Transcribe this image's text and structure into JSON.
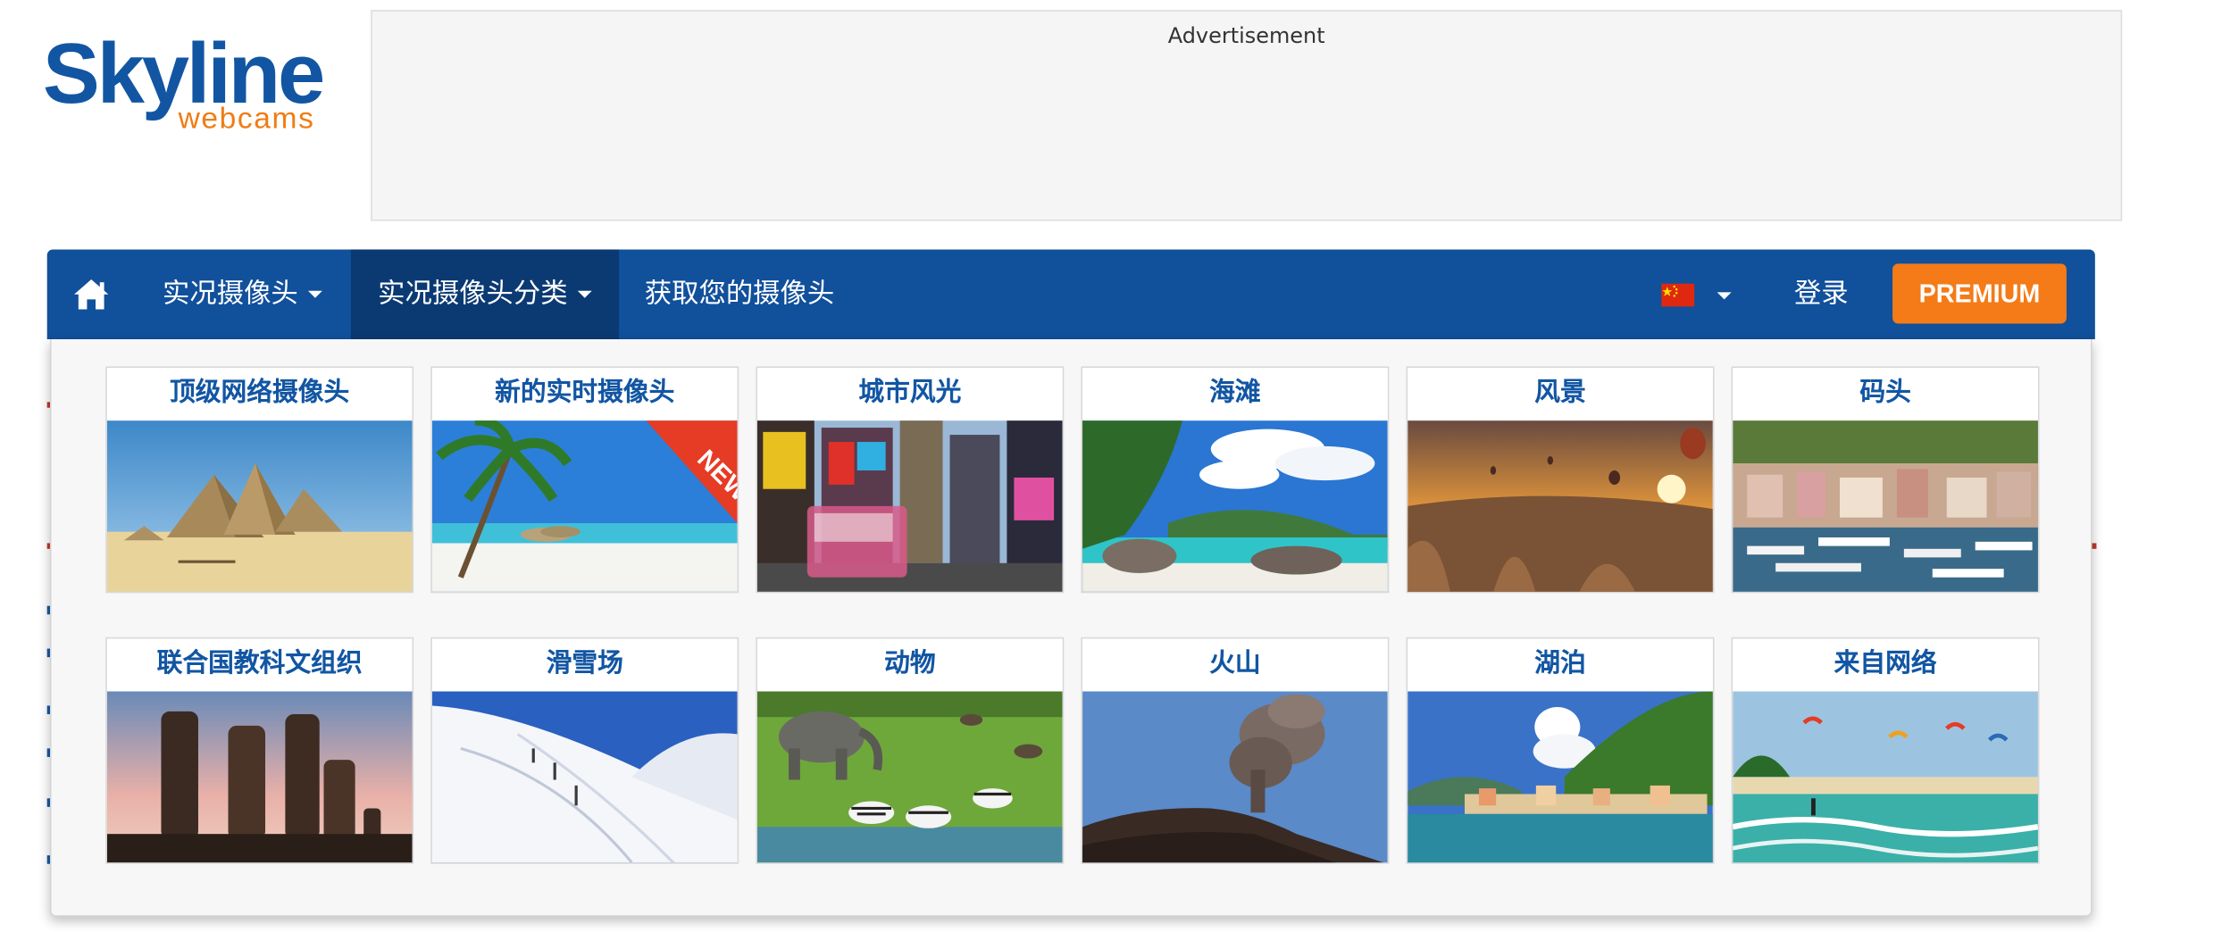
{
  "logo": {
    "main": "Skyline",
    "sub": "webcams"
  },
  "ad": {
    "label": "Advertisement"
  },
  "nav": {
    "home_icon": "home-icon",
    "items": [
      {
        "label": "实况摄像头",
        "has_caret": true
      },
      {
        "label": "实况摄像头分类",
        "has_caret": true,
        "active": true
      },
      {
        "label": "获取您的摄像头",
        "has_caret": false
      }
    ],
    "language_flag": "china-flag-icon",
    "login": "登录",
    "premium": "PREMIUM"
  },
  "categories": [
    {
      "title": "顶级网络摄像头",
      "image": "pyramids"
    },
    {
      "title": "新的实时摄像头",
      "image": "beach-palm",
      "badge": "NEW"
    },
    {
      "title": "城市风光",
      "image": "times-square"
    },
    {
      "title": "海滩",
      "image": "tropical-beach"
    },
    {
      "title": "风景",
      "image": "balloons-sunset"
    },
    {
      "title": "码头",
      "image": "harbor"
    },
    {
      "title": "联合国教科文组织",
      "image": "moai"
    },
    {
      "title": "滑雪场",
      "image": "ski-slope"
    },
    {
      "title": "动物",
      "image": "safari"
    },
    {
      "title": "火山",
      "image": "volcano"
    },
    {
      "title": "湖泊",
      "image": "lake-village"
    },
    {
      "title": "来自网络",
      "image": "kitesurf-beach"
    }
  ],
  "colors": {
    "nav_bg": "#11509b",
    "nav_active": "#0b3a73",
    "premium": "#f47b18",
    "title_blue": "#1256a3",
    "logo_orange": "#f07c14"
  }
}
